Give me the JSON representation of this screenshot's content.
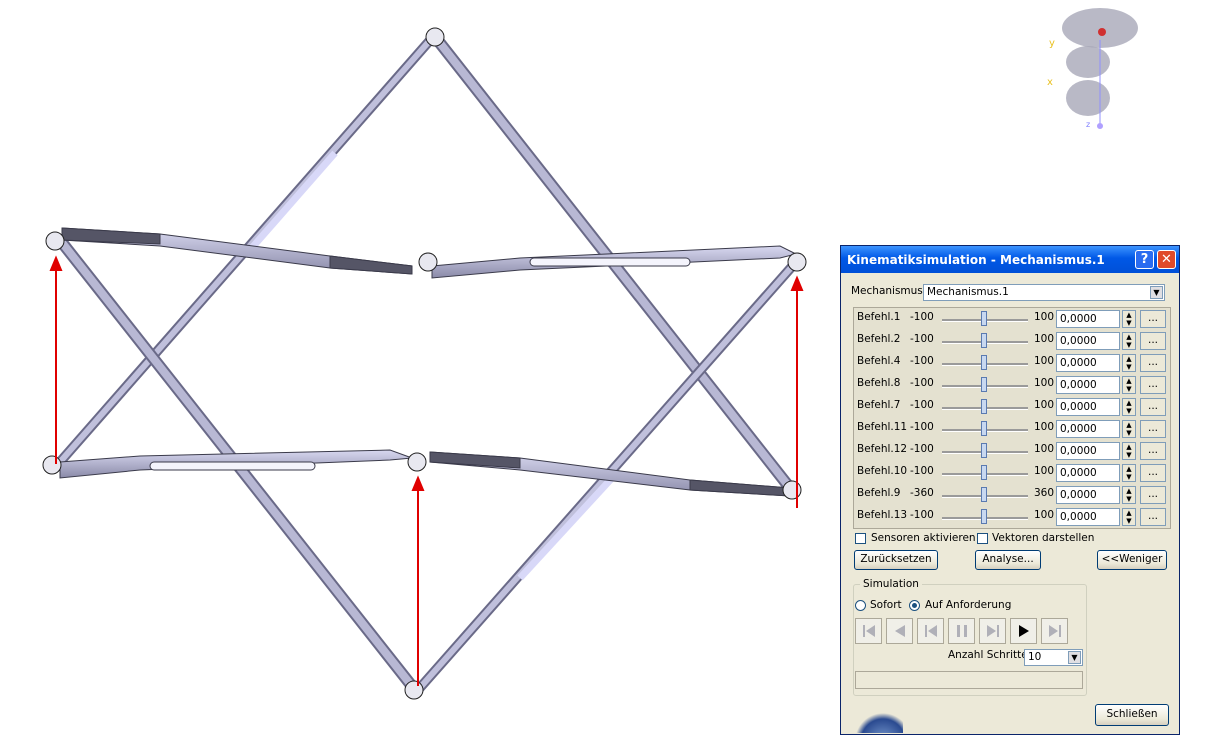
{
  "compass": {
    "y_label": "y",
    "x_label": "x",
    "z_label": "z"
  },
  "dialog": {
    "title": "Kinematiksimulation - Mechanismus.1",
    "help_label": "?",
    "close_label": "✕",
    "mechanism_label": "Mechanismus:",
    "mechanism_value": "Mechanismus.1",
    "commands": [
      {
        "name": "Befehl.1",
        "min": "-100",
        "max": "100",
        "value": "0,0000"
      },
      {
        "name": "Befehl.2",
        "min": "-100",
        "max": "100",
        "value": "0,0000"
      },
      {
        "name": "Befehl.4",
        "min": "-100",
        "max": "100",
        "value": "0,0000"
      },
      {
        "name": "Befehl.8",
        "min": "-100",
        "max": "100",
        "value": "0,0000"
      },
      {
        "name": "Befehl.7",
        "min": "-100",
        "max": "100",
        "value": "0,0000"
      },
      {
        "name": "Befehl.11",
        "min": "-100",
        "max": "100",
        "value": "0,0000"
      },
      {
        "name": "Befehl.12",
        "min": "-100",
        "max": "100",
        "value": "0,0000"
      },
      {
        "name": "Befehl.10",
        "min": "-100",
        "max": "100",
        "value": "0,0000"
      },
      {
        "name": "Befehl.9",
        "min": "-360",
        "max": "360",
        "value": "0,0000"
      },
      {
        "name": "Befehl.13",
        "min": "-100",
        "max": "100",
        "value": "0,0000"
      }
    ],
    "dots_label": "...",
    "sensors_label": "Sensoren aktivieren",
    "sensors_checked": false,
    "vectors_label": "Vektoren darstellen",
    "vectors_checked": false,
    "reset_label": "Zurücksetzen",
    "analyse_label": "Analyse...",
    "less_label": "<<Weniger",
    "simulation_label": "Simulation",
    "immediate_label": "Sofort",
    "on_request_label": "Auf Anforderung",
    "selected_mode": "on_request",
    "steps_label": "Anzahl Schritte:",
    "steps_value": "10",
    "close_button_label": "Schließen",
    "accent_color": "#0058e6"
  }
}
